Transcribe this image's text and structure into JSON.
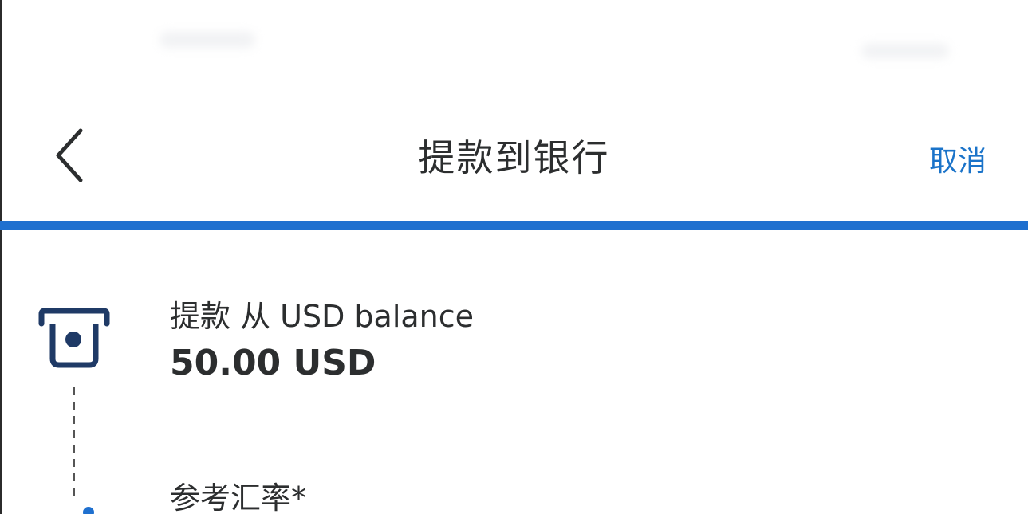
{
  "header": {
    "title": "提款到银行",
    "cancel_label": "取消"
  },
  "progress": {
    "fraction": 1.0,
    "color": "#1f70cf"
  },
  "transfer": {
    "from_label": "提款 从 USD balance",
    "amount": "50.00 USD",
    "rate_label": "参考汇率*"
  },
  "colors": {
    "accent": "#1a73c9",
    "text": "#2c2e2f",
    "icon": "#1f3a66"
  },
  "icons": {
    "back": "chevron-left-icon",
    "bank": "bank-withdraw-icon"
  }
}
